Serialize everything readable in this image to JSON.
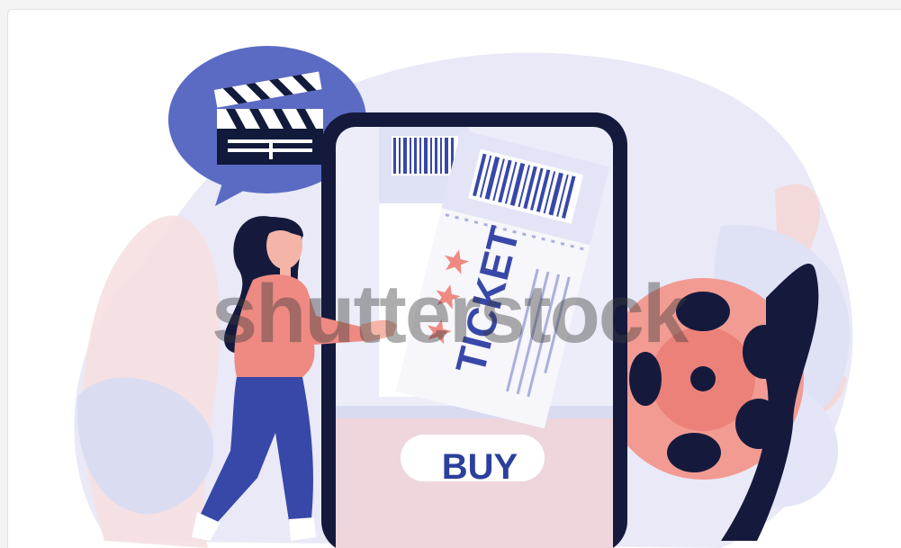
{
  "illustration": {
    "ticket_text": "TICKET",
    "buy_button_label": "BUY",
    "watermark": "shutterstock"
  },
  "colors": {
    "background_blob": "#e9e9f7",
    "pink_blob": "#f4dede",
    "phone_dark": "#151a3d",
    "phone_screen": "#ecedf9",
    "accent_blue": "#3848a8",
    "coral": "#ee8a82",
    "film_reel": "#f29b93"
  }
}
